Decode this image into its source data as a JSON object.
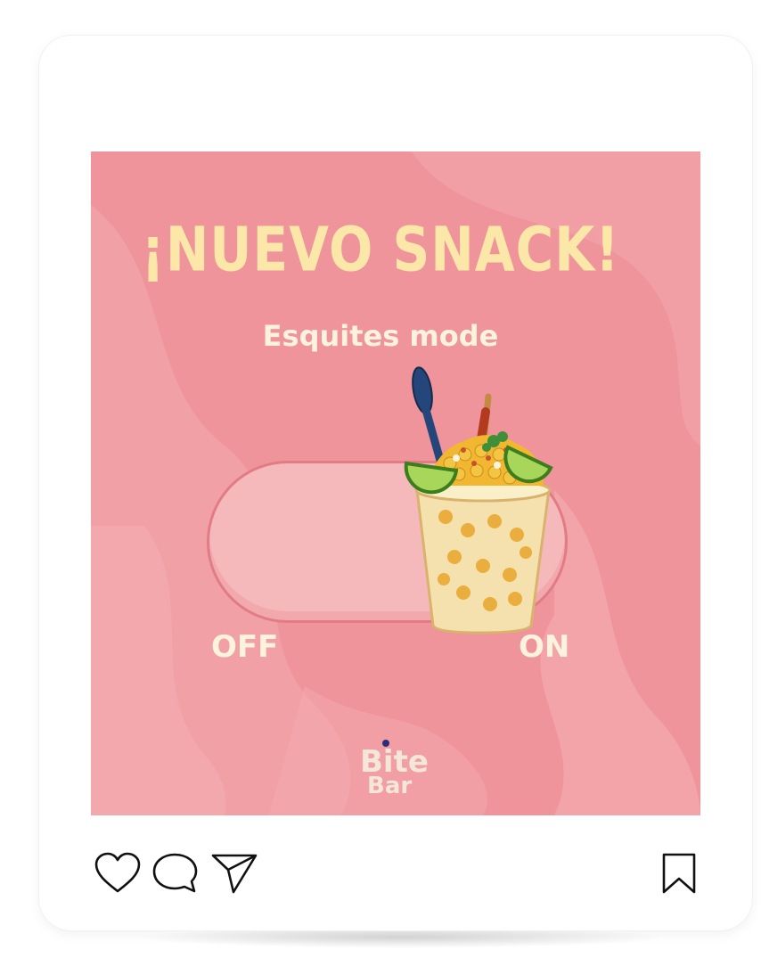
{
  "post": {
    "headline": "¡NUEVO SNACK!",
    "subheadline": "Esquites mode",
    "toggle": {
      "off_label": "OFF",
      "on_label": "ON",
      "state": "on"
    },
    "brand": {
      "logo_text": "Bite Bar",
      "logo_line1": "Bite",
      "logo_line2": "Bar"
    },
    "illustration": "esquites-cup"
  },
  "actions": {
    "like": "heart-icon",
    "comment": "comment-bubble-icon",
    "share": "paper-plane-icon",
    "save": "bookmark-icon"
  },
  "colors": {
    "background": "#ef949b",
    "headline": "#fbe7a8",
    "subtext": "#fdf3dc",
    "toggle_track": "#f6b9bb",
    "toggle_border": "#e27c84"
  }
}
